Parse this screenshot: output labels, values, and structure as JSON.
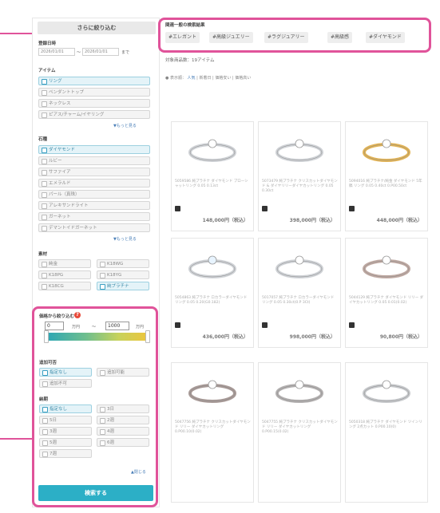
{
  "sidebar": {
    "heading": "さらに絞り込む",
    "period": {
      "label": "登録日時",
      "from": "2026/01/01",
      "sep": "〜",
      "to": "2026/01/01",
      "until": "まで"
    },
    "item": {
      "label": "アイテム",
      "options": [
        "リング",
        "ペンダントトップ",
        "ネックレス",
        "ピアス/チャーム/イヤリング"
      ],
      "selected": [
        0
      ],
      "more": "▼もっと見る"
    },
    "stone": {
      "label": "石種",
      "options": [
        "ダイヤモンド",
        "ルビー",
        "サファイア",
        "エメラルド",
        "パール（真珠）",
        "アレキサンドライト",
        "ガーネット",
        "デマントイドガーネット"
      ],
      "selected": [
        0
      ],
      "more": "▼もっと見る"
    },
    "material": {
      "label": "素材",
      "options": [
        "純金",
        "K18WG",
        "K18PG",
        "K18YG",
        "K18CG",
        "純プラチナ"
      ],
      "selected": [
        5
      ]
    },
    "price": {
      "title": "価格から絞り込む",
      "help": "?",
      "min": "0",
      "min_unit": "万円",
      "sep": "〜",
      "max": "1000",
      "max_unit": "万円"
    },
    "engrave": {
      "label": "追加可否",
      "options": [
        "指定なし",
        "追加可能",
        "追加不可"
      ],
      "selected": [
        0
      ]
    },
    "size": {
      "label": "納期",
      "options": [
        "指定なし",
        "3日",
        "5日",
        "2週",
        "3週",
        "4週",
        "5週",
        "6週",
        "7週"
      ],
      "selected": [
        0
      ]
    },
    "close": "▲閉じる",
    "search_button": "検索する"
  },
  "keywords": {
    "title": "関連一般の検索結果",
    "tags": [
      "#エレガント",
      "#高級ジュエリー",
      "#ラグジュアリー",
      "#高級感",
      "#ダイヤモンド"
    ]
  },
  "results": {
    "count": "対象商品数：19アイテム",
    "sort_label": "● 表示順：",
    "sort_options": [
      "人気",
      "新着日",
      "価格安い",
      "価格高い"
    ]
  },
  "products": [
    {
      "name": "5059586 純プラチナ ダイヤモンド プローシャットリング 0.05 0.13ct",
      "price": "148,000円（税込）",
      "stone": "#ffffff",
      "metal": "#cfd2d6"
    },
    {
      "name": "5073479 純プラチナ クリスカットダイヤモンド & ダイヤリリーダイヤカットリング 0.05 0.30ct",
      "price": "398,000円（税込）",
      "stone": "#ffffff",
      "metal": "#cfd2d6"
    },
    {
      "name": "5094016 純プラチナ/純金 ダイヤモンド 5年稿 リング 0.05 0.40ct 0.P00.50ct",
      "price": "448,000円（税込）",
      "stone": "#ffffff",
      "metal": "#e2b355"
    },
    {
      "name": "5054863 純プラチナ ロカラーダイヤモンド リング 0.05 0.20(G0.182)",
      "price": "436,000円（税込）",
      "stone": "#e8f4ff",
      "metal": "#cfd2d6"
    },
    {
      "name": "5017057 純プラチナ ロカラーダイヤモンド リング 0.05 0.30ct(0.P 3Ct)",
      "price": "998,000円（税込）",
      "stone": "#ffffff",
      "metal": "#cfd2d6"
    },
    {
      "name": "5044129 純プラチナ ダイヤモンド リリー ダイヤカットリング 0.05 0.01(0.02)",
      "price": "90,800円（税込）",
      "stone": "#ffffff",
      "metal": "#bfa9a2"
    },
    {
      "name": "5047756 純プラチナ クリスカットダイヤモンド リリー ダイヤカットリング 0.P00.10(0.02)",
      "price": "",
      "stone": "#ffffff",
      "metal": "#a89a97"
    },
    {
      "name": "5047755 純プラチナ クリスカットダイヤモンド リリー ダイヤカットリング 0.P00.15(0.02)",
      "price": "",
      "stone": "#ffffff",
      "metal": "#b3b0b0"
    },
    {
      "name": "5050318 純プラチナ ダイヤモンド ツインリング 2点カット 0.P00.10(0)",
      "price": "",
      "stone": "#ffffff",
      "metal": "#c7c9cc"
    }
  ]
}
